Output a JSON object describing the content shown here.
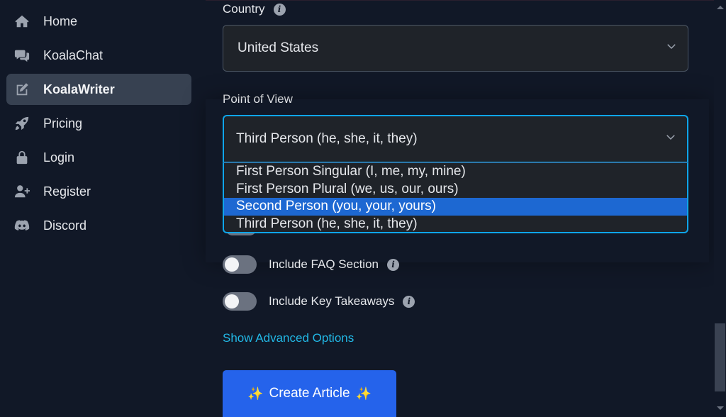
{
  "sidebar": {
    "items": [
      {
        "label": "Home",
        "icon": "home-icon",
        "active": false
      },
      {
        "label": "KoalaChat",
        "icon": "chat-icon",
        "active": false
      },
      {
        "label": "KoalaWriter",
        "icon": "edit-icon",
        "active": true
      },
      {
        "label": "Pricing",
        "icon": "rocket-icon",
        "active": false
      },
      {
        "label": "Login",
        "icon": "lock-icon",
        "active": false
      },
      {
        "label": "Register",
        "icon": "user-plus-icon",
        "active": false
      },
      {
        "label": "Discord",
        "icon": "discord-icon",
        "active": false
      }
    ]
  },
  "form": {
    "country": {
      "label": "Country",
      "value": "United States"
    },
    "point_of_view": {
      "label": "Point of View",
      "value": "Third Person (he, she, it, they)",
      "options": [
        "First Person Singular (I, me, my, mine)",
        "First Person Plural (we, us, our, ours)",
        "Second Person (you, your, yours)",
        "Third Person (he, she, it, they)"
      ],
      "highlighted_option": "Second Person (you, your, yours)"
    },
    "toggles": [
      {
        "label": "Include FAQ Section",
        "on": false
      },
      {
        "label": "Include Key Takeaways",
        "on": false
      }
    ],
    "advanced_link": "Show Advanced Options",
    "submit": {
      "label": "Create Article",
      "icon": "sparkles-icon",
      "sparkle_glyph": "✨"
    }
  },
  "colors": {
    "accent": "#2563eb",
    "focus_ring": "#0ea5e9",
    "link": "#22b8e6",
    "highlight": "#1d68d2"
  }
}
